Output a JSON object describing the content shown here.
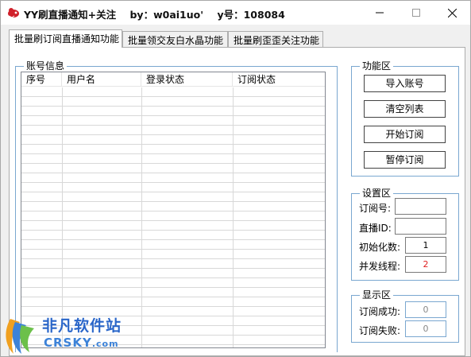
{
  "window": {
    "title": "YY刷直播通知+关注    by：w0ai1uo'    y号：108084"
  },
  "tabs": [
    {
      "label": "批量刷订阅直播通知功能",
      "active": true
    },
    {
      "label": "批量领交友白水晶功能",
      "active": false
    },
    {
      "label": "批量刷歪歪关注功能",
      "active": false
    }
  ],
  "account_group": {
    "label": "账号信息",
    "columns": [
      "序号",
      "用户名",
      "登录状态",
      "订阅状态"
    ]
  },
  "function_group": {
    "label": "功能区",
    "buttons": [
      "导入账号",
      "清空列表",
      "开始订阅",
      "暂停订阅"
    ]
  },
  "settings_group": {
    "label": "设置区",
    "rows": [
      {
        "label": "订阅号:",
        "value": ""
      },
      {
        "label": "直播ID:",
        "value": ""
      },
      {
        "label": "初始化数:",
        "value": "1"
      },
      {
        "label": "并发线程:",
        "value": "2"
      }
    ]
  },
  "display_group": {
    "label": "显示区",
    "rows": [
      {
        "label": "订阅成功:",
        "value": "0"
      },
      {
        "label": "订阅失败:",
        "value": "0"
      }
    ]
  },
  "watermark": {
    "cn": "非凡软件站",
    "en": "CRSKY",
    "en_suffix": ".com"
  },
  "colors": {
    "group_border": "#7aa7d0",
    "thread_value": "#e02020",
    "watermark": "#2a66c9"
  }
}
